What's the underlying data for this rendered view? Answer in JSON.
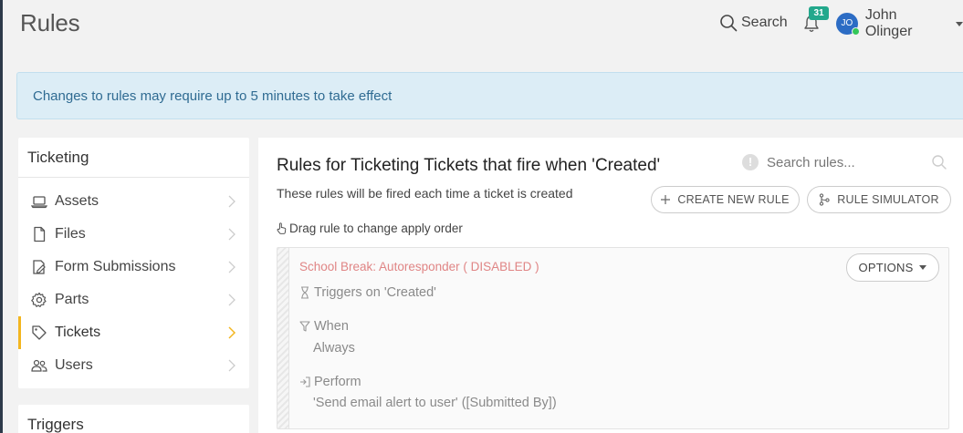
{
  "header": {
    "title": "Rules",
    "search_label": "Search",
    "notification_count": "31",
    "user_initials": "JO",
    "user_name": "John Olinger"
  },
  "banner": {
    "text": "Changes to rules may require up to 5 minutes to take effect"
  },
  "sidebar": {
    "title": "Ticketing",
    "items": [
      {
        "label": "Assets",
        "icon": "laptop-icon"
      },
      {
        "label": "Files",
        "icon": "file-icon"
      },
      {
        "label": "Form Submissions",
        "icon": "form-icon"
      },
      {
        "label": "Parts",
        "icon": "gear-icon"
      },
      {
        "label": "Tickets",
        "icon": "tag-icon",
        "active": true
      },
      {
        "label": "Users",
        "icon": "users-icon"
      }
    ],
    "second_title": "Triggers"
  },
  "main": {
    "title": "Rules for Ticketing Tickets that fire when 'Created'",
    "subtitle": "These rules will be fired each time a ticket is created",
    "search_placeholder": "Search rules...",
    "create_button": "CREATE NEW RULE",
    "simulator_button": "RULE SIMULATOR",
    "drag_hint": "Drag rule to change apply order"
  },
  "rule": {
    "name": "School Break: Autoresponder ( DISABLED )",
    "options_label": "OPTIONS",
    "triggers": "Triggers on 'Created'",
    "when_label": "When",
    "when_value": "Always",
    "perform_label": "Perform",
    "perform_value": "'Send email alert to user' ([Submitted By])"
  },
  "colors": {
    "accent_active": "#f3b61f",
    "badge": "#23a88c",
    "banner_bg": "#dcedf6",
    "banner_text": "#2f6b92",
    "disabled_rule": "#e08585",
    "avatar": "#2c6cc4"
  }
}
